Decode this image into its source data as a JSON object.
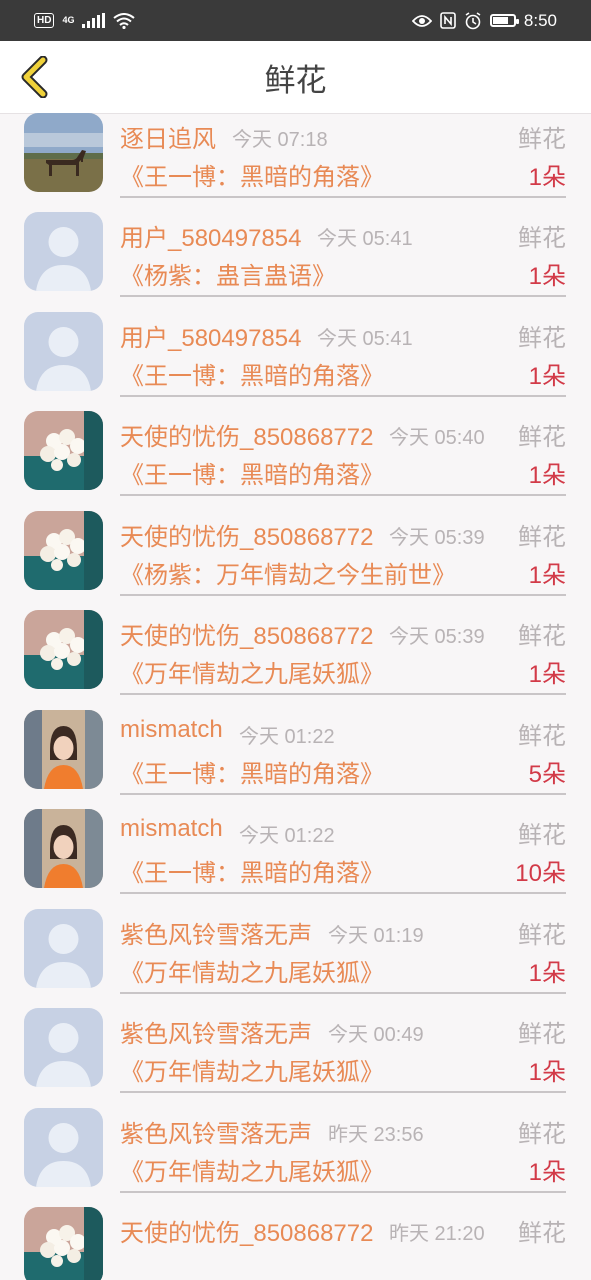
{
  "status_bar": {
    "hd": "HD",
    "network": "4G",
    "time": "8:50",
    "icons": [
      "hd-icon",
      "signal-icon",
      "wifi-icon",
      "eye-icon",
      "nfc-icon",
      "alarm-icon",
      "battery-icon"
    ],
    "battery_level": 0.7
  },
  "header": {
    "title": "鲜花",
    "back_icon": "chevron-left-icon"
  },
  "colors": {
    "name": "#e88a55",
    "count": "#d23a48",
    "muted": "#b8b3b5",
    "back": "#f0d23a"
  },
  "items": [
    {
      "name": "",
      "time": "",
      "type": "",
      "work": "《万年情劫之九尾妖狐》",
      "count": "1朵",
      "avatar": "horse"
    },
    {
      "name": "逐日追风",
      "time": "今天 07:18",
      "type": "鲜花",
      "work": "《王一博：黑暗的角落》",
      "count": "1朵",
      "avatar": "horse"
    },
    {
      "name": "用户_580497854",
      "time": "今天 05:41",
      "type": "鲜花",
      "work": "《杨紫：蛊言蛊语》",
      "count": "1朵",
      "avatar": "default"
    },
    {
      "name": "用户_580497854",
      "time": "今天 05:41",
      "type": "鲜花",
      "work": "《王一博：黑暗的角落》",
      "count": "1朵",
      "avatar": "default"
    },
    {
      "name": "天使的忧伤_850868772",
      "time": "今天 05:40",
      "type": "鲜花",
      "work": "《王一博：黑暗的角落》",
      "count": "1朵",
      "avatar": "flowers"
    },
    {
      "name": "天使的忧伤_850868772",
      "time": "今天 05:39",
      "type": "鲜花",
      "work": "《杨紫：万年情劫之今生前世》",
      "count": "1朵",
      "avatar": "flowers"
    },
    {
      "name": "天使的忧伤_850868772",
      "time": "今天 05:39",
      "type": "鲜花",
      "work": "《万年情劫之九尾妖狐》",
      "count": "1朵",
      "avatar": "flowers"
    },
    {
      "name": "mismatch",
      "time": "今天 01:22",
      "type": "鲜花",
      "work": "《王一博：黑暗的角落》",
      "count": "5朵",
      "avatar": "girl"
    },
    {
      "name": "mismatch",
      "time": "今天 01:22",
      "type": "鲜花",
      "work": "《王一博：黑暗的角落》",
      "count": "10朵",
      "avatar": "girl"
    },
    {
      "name": "紫色风铃雪落无声",
      "time": "今天 01:19",
      "type": "鲜花",
      "work": "《万年情劫之九尾妖狐》",
      "count": "1朵",
      "avatar": "default"
    },
    {
      "name": "紫色风铃雪落无声",
      "time": "今天 00:49",
      "type": "鲜花",
      "work": "《万年情劫之九尾妖狐》",
      "count": "1朵",
      "avatar": "default"
    },
    {
      "name": "紫色风铃雪落无声",
      "time": "昨天 23:56",
      "type": "鲜花",
      "work": "《万年情劫之九尾妖狐》",
      "count": "1朵",
      "avatar": "default"
    },
    {
      "name": "天使的忧伤_850868772",
      "time": "昨天 21:20",
      "type": "鲜花",
      "work": "",
      "count": "",
      "avatar": "flowers"
    }
  ]
}
